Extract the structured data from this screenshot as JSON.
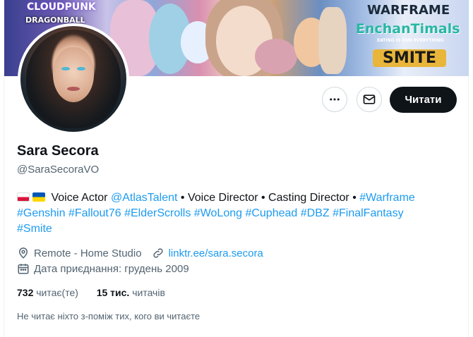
{
  "banner": {
    "logos": [
      "CLOUDPUNK",
      "DRAGONBALL",
      "WARFRAME",
      "EnchanTimals",
      "EATING IS OUR EVERYTHING",
      "SMITE"
    ]
  },
  "actions": {
    "more_icon": "more-icon",
    "message_icon": "envelope-icon",
    "follow_label": "Читати"
  },
  "profile": {
    "name": "Sara Secora",
    "handle": "@SaraSecoraVO",
    "bio": {
      "flags": [
        "poland-flag",
        "ukraine-flag"
      ],
      "text1": "Voice Actor",
      "mention": "@AtlasTalent",
      "text2": "• Voice Director • Casting Director •",
      "hashtags_line1": "#Warframe",
      "hashtags_line2": "#Genshin #Fallout76 #ElderScrolls #WoLong #Cuphead #DBZ #FinalFantasy",
      "hashtags_line3": "#Smite"
    },
    "location": "Remote - Home Studio",
    "website": "linktr.ee/sara.secora",
    "joined": "Дата приєднання: грудень 2009"
  },
  "stats": {
    "following_count": "732",
    "following_label": "читає(те)",
    "followers_count": "15 тис.",
    "followers_label": "читачів"
  },
  "mutuals_note": "Не читає ніхто з-поміж тих, кого ви читаєте"
}
